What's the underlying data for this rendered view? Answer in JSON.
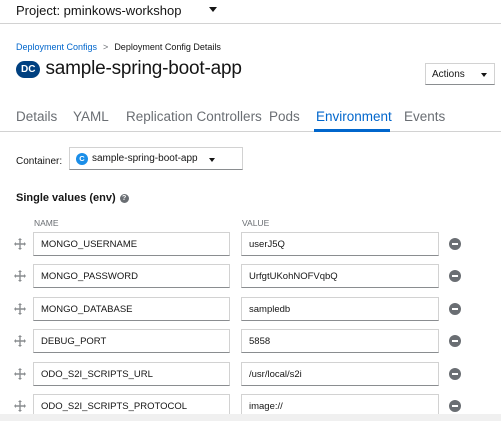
{
  "project_bar": {
    "label": "Project: pminkows-workshop"
  },
  "breadcrumb": {
    "parent": "Deployment Configs",
    "separator": ">",
    "current": "Deployment Config Details"
  },
  "header": {
    "badge": "DC",
    "title": "sample-spring-boot-app",
    "actions_label": "Actions"
  },
  "tabs": [
    {
      "label": "Details"
    },
    {
      "label": "YAML"
    },
    {
      "label": "Replication Controllers"
    },
    {
      "label": "Pods"
    },
    {
      "label": "Environment",
      "active": true
    },
    {
      "label": "Events"
    }
  ],
  "container": {
    "label": "Container:",
    "badge": "C",
    "selected": "sample-spring-boot-app"
  },
  "env_section": {
    "title": "Single values (env)",
    "name_header": "NAME",
    "value_header": "VALUE",
    "rows": [
      {
        "name": "MONGO_USERNAME",
        "value": "userJ5Q"
      },
      {
        "name": "MONGO_PASSWORD",
        "value": "UrfgtUKohNOFVqbQ"
      },
      {
        "name": "MONGO_DATABASE",
        "value": "sampledb"
      },
      {
        "name": "DEBUG_PORT",
        "value": "5858"
      },
      {
        "name": "ODO_S2I_SCRIPTS_URL",
        "value": "/usr/local/s2i"
      },
      {
        "name": "ODO_S2I_SCRIPTS_PROTOCOL",
        "value": "image://"
      }
    ]
  },
  "colors": {
    "link": "#0066cc",
    "badge_dc": "#004080",
    "badge_c": "#1b8ee8",
    "muted": "#6a6e73"
  },
  "icons": {
    "drag": "drag-handle-icon",
    "remove": "minus-circle-icon",
    "help": "help-icon",
    "caret": "caret-down-icon"
  }
}
